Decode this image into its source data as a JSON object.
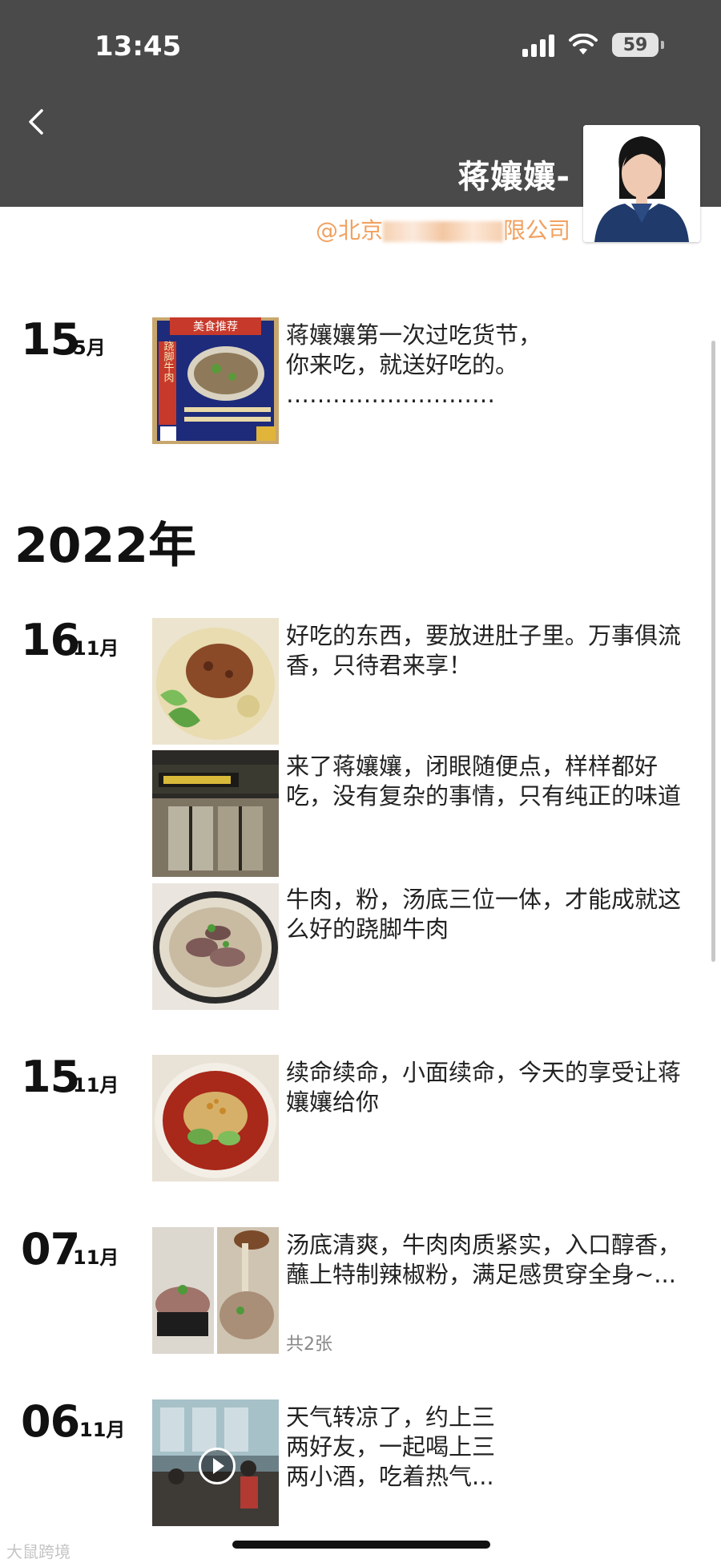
{
  "status_bar": {
    "time": "13:45",
    "battery": "59"
  },
  "header": {
    "name": "蒋孃孃-",
    "company_prefix": "@北京",
    "company_suffix": "限公司"
  },
  "year_label": "2022年",
  "posts": [
    {
      "day": "15",
      "month": "5月",
      "caption": "蒋孃孃第一次过吃货节，\n你来吃，就送好吃的。\n………………………",
      "image": "food-poster"
    },
    {
      "day": "16",
      "month": "11月",
      "caption": "好吃的东西，要放进肚子里。万事俱流香，只待君来享！",
      "image": "noodles-bowl"
    },
    {
      "day": "",
      "month": "",
      "caption": "来了蒋孃孃，闭眼随便点，样样都好吃，没有复杂的事情，只有纯正的味道",
      "image": "restaurant-front"
    },
    {
      "day": "",
      "month": "",
      "caption": "牛肉，粉，汤底三位一体，才能成就这么好的跷脚牛肉",
      "image": "beef-soup"
    },
    {
      "day": "15",
      "month": "11月",
      "caption": "续命续命，小面续命，今天的享受让蒋孃孃给你",
      "image": "spicy-noodles"
    },
    {
      "day": "07",
      "month": "11月",
      "caption": "汤底清爽，牛肉肉质紧实，入口醇香，蘸上特制辣椒粉，满足感贯穿全身~...",
      "image": "beef-pair",
      "count_label": "共2张"
    },
    {
      "day": "06",
      "month": "11月",
      "caption": "天气转凉了，约上三\n两好友，一起喝上三\n两小酒，吃着热气...",
      "image": "video-dining"
    }
  ],
  "poster_texts": {
    "banner": "美食推荐",
    "side": "跷脚牛肉"
  },
  "watermark": "大鼠跨境",
  "colors": {
    "header_bg": "#4a4a4a",
    "company": "#f2a15f"
  }
}
